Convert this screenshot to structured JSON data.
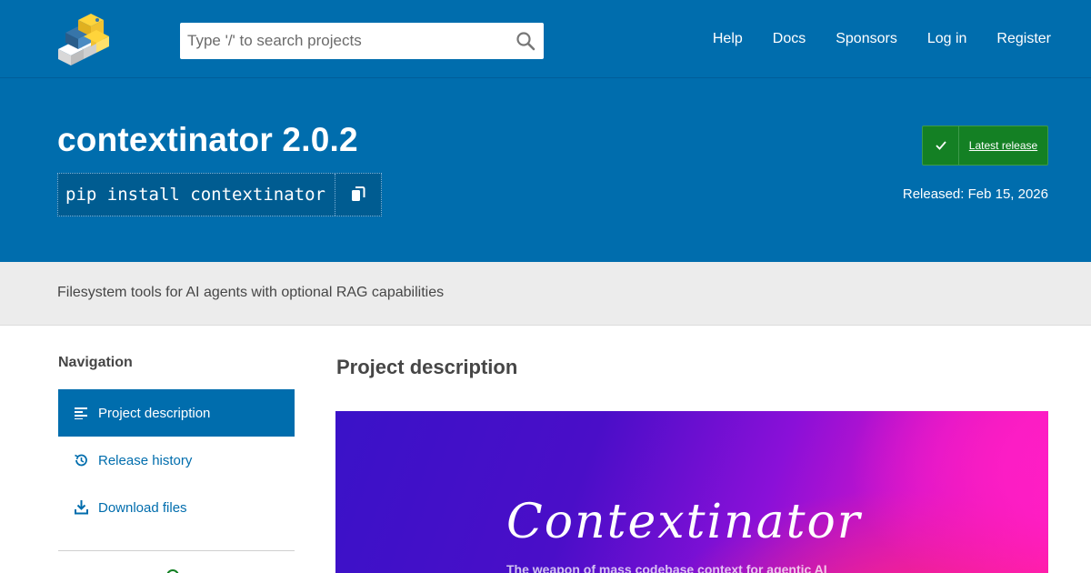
{
  "header": {
    "search_placeholder": "Type '/' to search projects",
    "nav": [
      "Help",
      "Docs",
      "Sponsors",
      "Log in",
      "Register"
    ]
  },
  "package": {
    "title": "contextinator 2.0.2",
    "pip_command": "pip install contextinator",
    "latest_label": "Latest release",
    "released": "Released: Feb 15, 2026",
    "summary": "Filesystem tools for AI agents with optional RAG capabilities"
  },
  "sidebar": {
    "heading": "Navigation",
    "items": [
      {
        "label": "Project description",
        "icon": "align-left-icon"
      },
      {
        "label": "Release history",
        "icon": "history-icon"
      },
      {
        "label": "Download files",
        "icon": "download-icon"
      }
    ]
  },
  "main": {
    "heading": "Project description",
    "hero_title": "Contextinator",
    "hero_subtitle": "The weapon of mass codebase context for agentic AI"
  },
  "colors": {
    "brand_blue": "#006dad",
    "success_green": "#148024"
  }
}
